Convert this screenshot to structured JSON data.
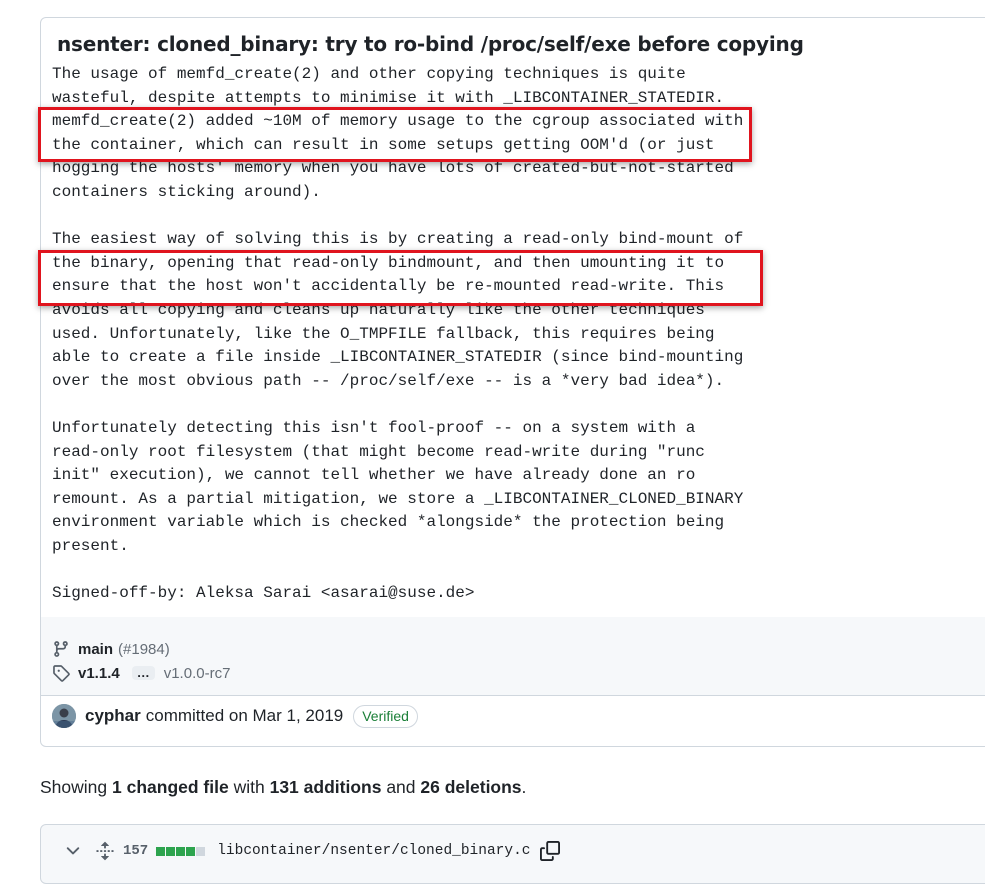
{
  "commit": {
    "title": "nsenter: cloned_binary: try to ro-bind /proc/self/exe before copying",
    "body": "The usage of memfd_create(2) and other copying techniques is quite\nwasteful, despite attempts to minimise it with _LIBCONTAINER_STATEDIR.\nmemfd_create(2) added ~10M of memory usage to the cgroup associated with\nthe container, which can result in some setups getting OOM'd (or just\nhogging the hosts' memory when you have lots of created-but-not-started\ncontainers sticking around).\n\nThe easiest way of solving this is by creating a read-only bind-mount of\nthe binary, opening that read-only bindmount, and then umounting it to\nensure that the host won't accidentally be re-mounted read-write. This\navoids all copying and cleans up naturally like the other techniques\nused. Unfortunately, like the O_TMPFILE fallback, this requires being\nable to create a file inside _LIBCONTAINER_STATEDIR (since bind-mounting\nover the most obvious path -- /proc/self/exe -- is a *very bad idea*).\n\nUnfortunately detecting this isn't fool-proof -- on a system with a\nread-only root filesystem (that might become read-write during \"runc\ninit\" execution), we cannot tell whether we have already done an ro\nremount. As a partial mitigation, we store a _LIBCONTAINER_CLONED_BINARY\nenvironment variable which is checked *alongside* the protection being\npresent.\n\nSigned-off-by: Aleksa Sarai <asarai@suse.de>",
    "branch": "main",
    "pr_ref": "(#1984)",
    "tag_latest": "v1.1.4",
    "tag_ellipsis": "…",
    "tag_oldest": "v1.0.0-rc7",
    "author": "cyphar",
    "committed_text": "committed on Mar 1, 2019",
    "verified_label": "Verified"
  },
  "summary": {
    "prefix": "Showing",
    "files_changed": "1 changed file",
    "with": "with",
    "additions": "131 additions",
    "and": "and",
    "deletions": "26 deletions",
    "end": "."
  },
  "file": {
    "change_count": "157",
    "diffstat_blocks": [
      "added",
      "added",
      "added",
      "added",
      "neutral"
    ],
    "path": "libcontainer/nsenter/cloned_binary.c"
  },
  "colors": {
    "added": "#2da44e",
    "neutral": "#d0d7de",
    "highlight": "#e0141e",
    "verified": "#1a7f37"
  },
  "icons": {
    "branch": "git-branch-icon",
    "tag": "tag-icon",
    "avatar": "user-avatar",
    "chevron": "chevron-down-icon",
    "expand": "unfold-icon",
    "copy": "copy-icon"
  }
}
